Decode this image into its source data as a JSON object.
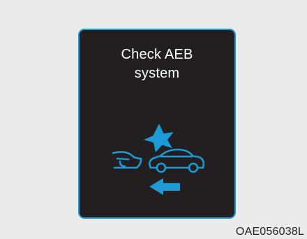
{
  "display": {
    "message_line1": "Check AEB",
    "message_line2": "system",
    "icon": "aeb-collision-warning-icon",
    "accent_color": "#1b9ad6",
    "panel_color": "#231f20",
    "text_color": "#ffffff"
  },
  "caption": {
    "code": "OAE056038L"
  }
}
